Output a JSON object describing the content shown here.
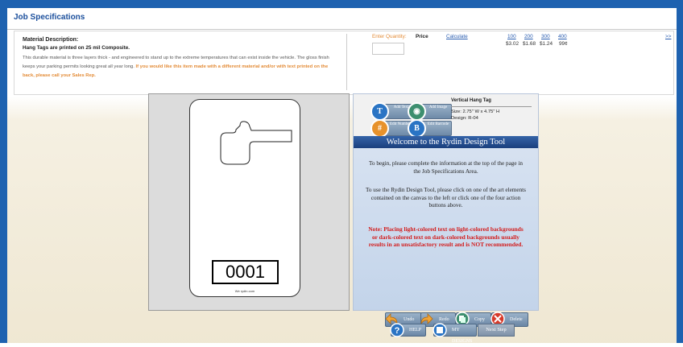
{
  "section": {
    "title": "Job Specifications"
  },
  "material": {
    "label": "Material Description:",
    "subtitle": "Hang Tags are printed on 25 mil Composite.",
    "description": "This durable material is three layers thick - and engineered to stand up to the extreme temperatures that can exist inside the vehicle. The gloss finish keeps your parking permits looking great all year long.",
    "note": "If you would like this item made with a different material and/or with text printed on the back, please call your Sales Rep."
  },
  "pricing": {
    "quantity_label": "Enter Quantity:",
    "quantity_value": "",
    "price_label": "Price",
    "calculate_label": "Calculate",
    "tiers": [
      {
        "qty": "100",
        "price": "$3.02"
      },
      {
        "qty": "200",
        "price": "$1.68"
      },
      {
        "qty": "300",
        "price": "$1.24"
      },
      {
        "qty": "400",
        "price": "99¢"
      }
    ],
    "more_label": ">>"
  },
  "canvas": {
    "tag_number": "0001",
    "tag_url": "We rydin.com"
  },
  "tool": {
    "actions": [
      {
        "label": "Add Text",
        "icon": "add-text-icon",
        "glyph": "T"
      },
      {
        "label": "Add Image",
        "icon": "add-image-icon",
        "glyph": "◉"
      },
      {
        "label": "Edit Numbers",
        "icon": "edit-numbers-icon",
        "glyph": "#"
      },
      {
        "label": "Edit Barcode",
        "icon": "edit-barcode-icon",
        "glyph": "B"
      }
    ],
    "product_title": "Vertical Hang Tag",
    "size": "Size: 2.75\" W x 4.75\" H",
    "design": "Design: R-04",
    "welcome_title": "Welcome to the Rydin Design Tool",
    "paragraph1": "To begin, please complete the information at the top of the page in the Job Specifications Area.",
    "paragraph2": "To use the Rydin Design Tool, please click on one of the art elements contained on the canvas to the left or click one of the four action buttons above.",
    "note": "Note: Placing light-colored text on light-colored backgrounds or dark-colored text on dark-colored backgrounds usually results in an unsatisfactory result and is NOT recommended."
  },
  "buttons": {
    "undo": "Undo",
    "redo": "Redo",
    "copy": "Copy",
    "delete": "Delete",
    "help": "HELP",
    "my_designs": "MY DESIGNS",
    "next_step": "Next Step"
  },
  "colors": {
    "frame": "#1e62b0",
    "accent_orange": "#e38b36",
    "link": "#2a5db0",
    "note_red": "#d31d1d"
  }
}
